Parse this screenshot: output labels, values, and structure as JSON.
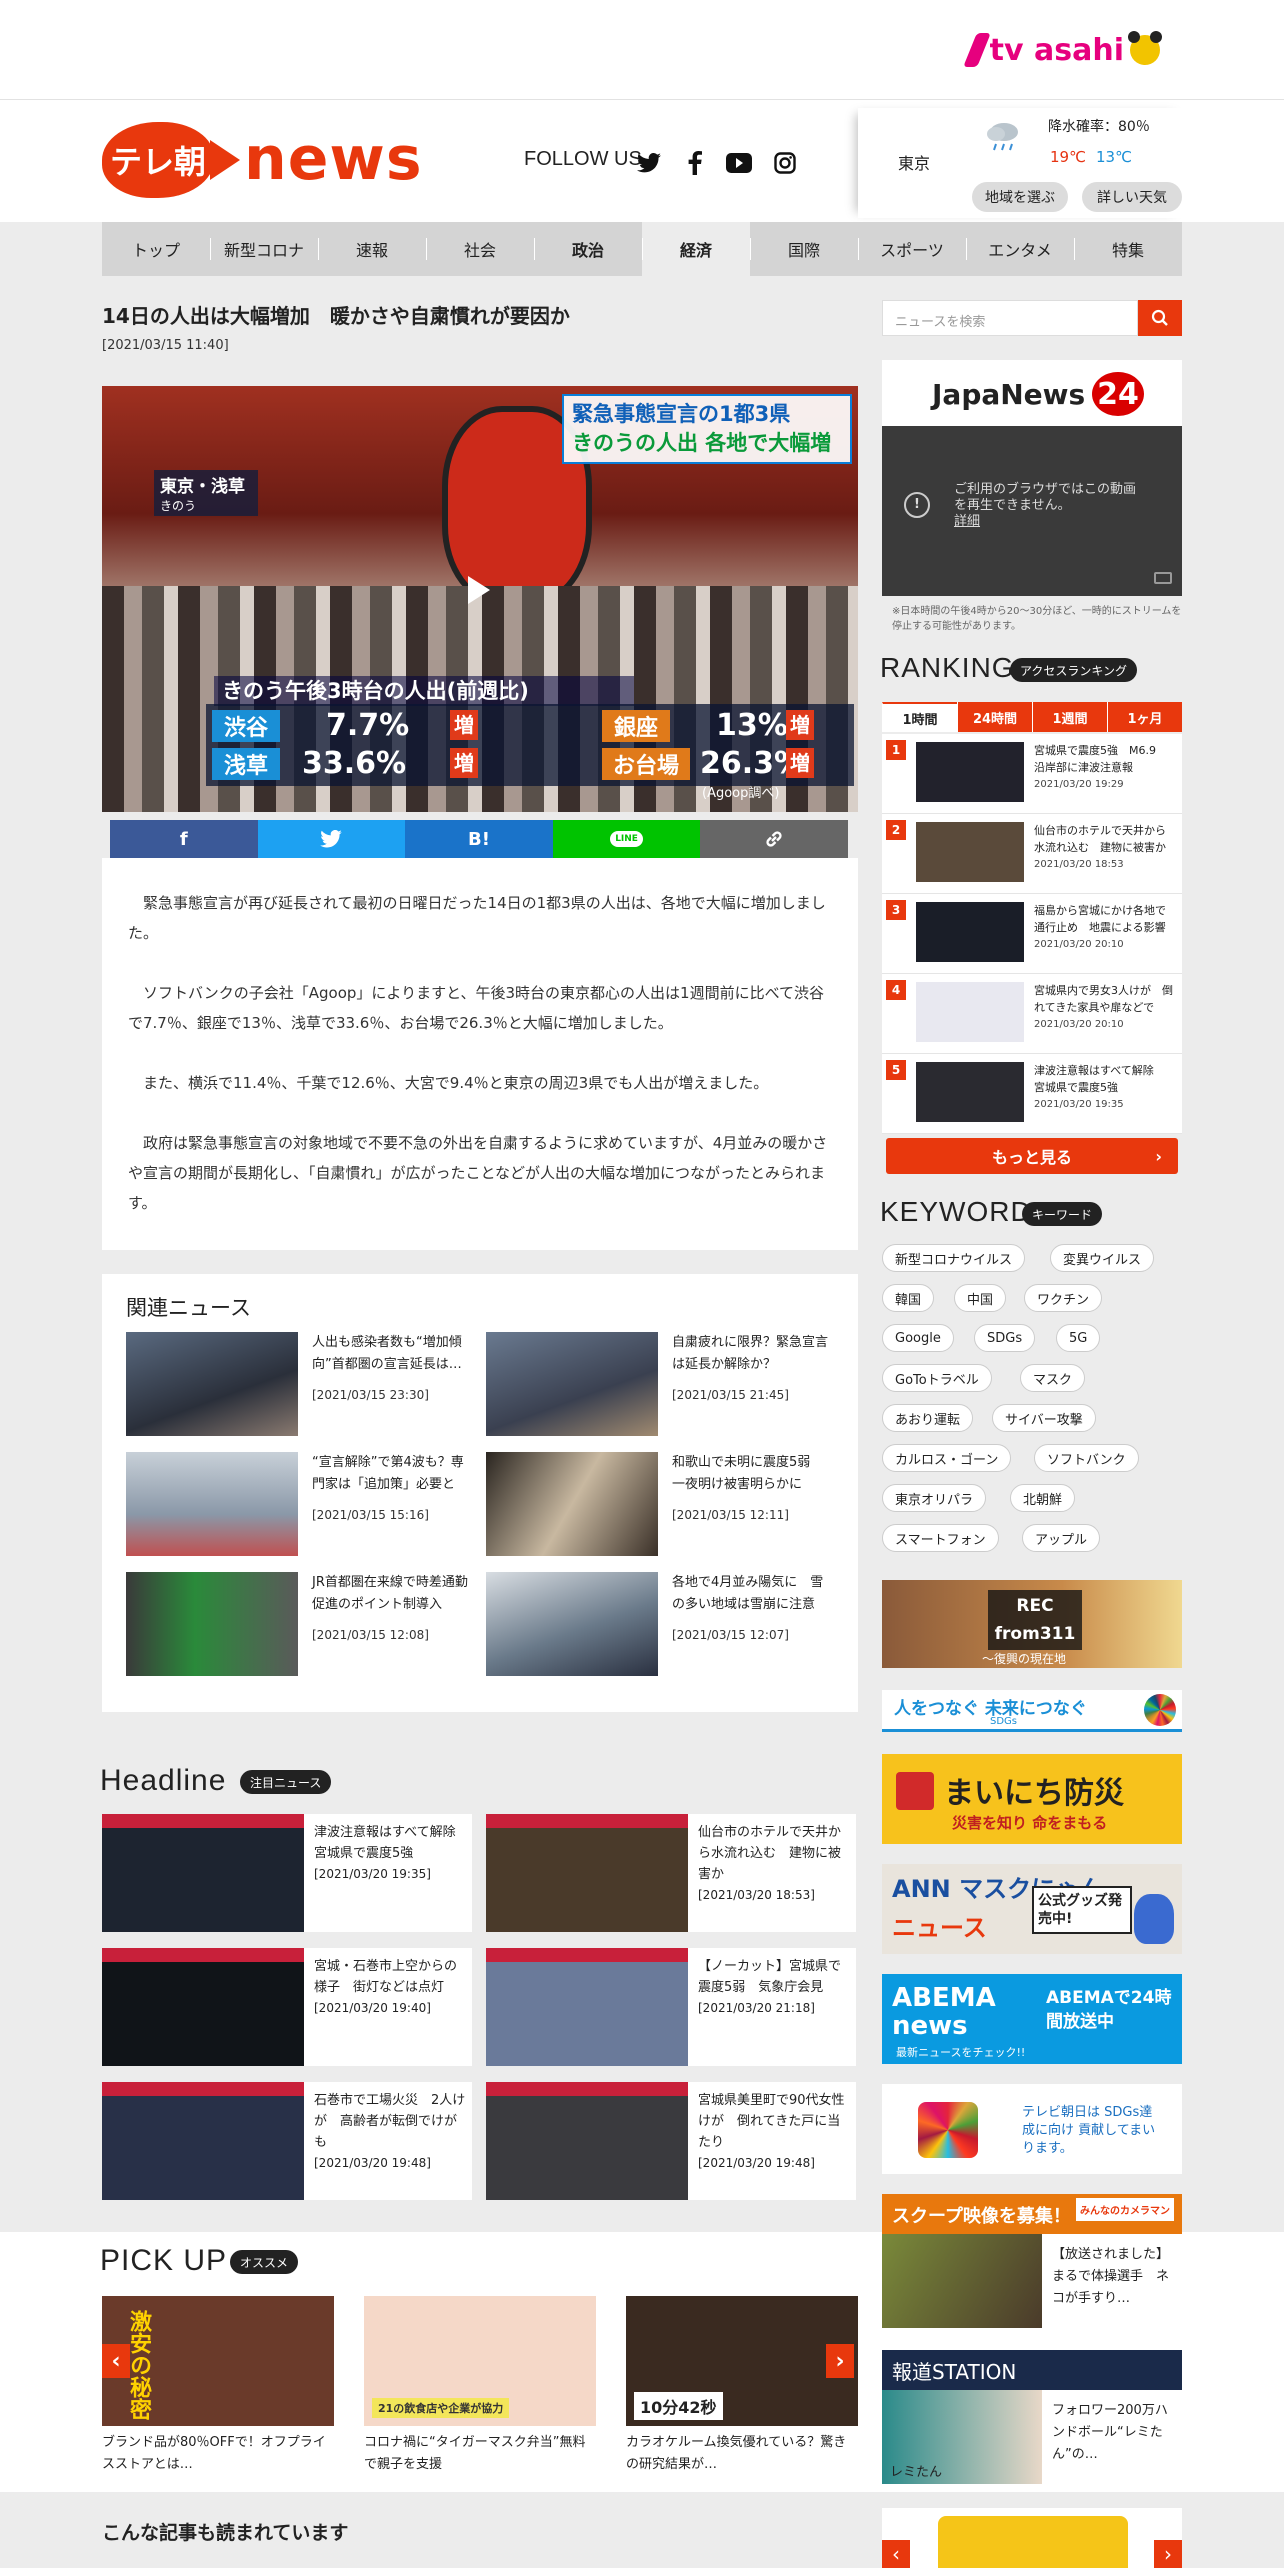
{
  "topbar": {
    "brand": "tv asahi"
  },
  "header": {
    "logo_jp": "テレ朝",
    "logo_en": "news",
    "follow_us": "FOLLOW US",
    "social": [
      "twitter-icon",
      "facebook-icon",
      "youtube-icon",
      "instagram-icon"
    ]
  },
  "weather": {
    "city": "東京",
    "rain": "降水確率：80％",
    "high": "19℃",
    "low": "13℃",
    "region_btn": "地域を選ぶ",
    "detail_btn": "詳しい天気"
  },
  "nav": {
    "items": [
      "トップ",
      "新型コロナ",
      "速報",
      "社会",
      "政治",
      "経済",
      "国際",
      "スポーツ",
      "エンタメ",
      "特集"
    ],
    "active": "経済"
  },
  "article": {
    "title": "14日の人出は大幅増加　暖かさや自粛慣れが要因か",
    "date": "[2021/03/15 11:40]",
    "video": {
      "banner_line1": "緊急事態宣言の1都3県",
      "banner_line2": "きのうの人出 各地で大幅増",
      "loc_line1": "東京・浅草",
      "loc_line2": "きのう",
      "caption": "きのう午後3時台の人出(前週比)",
      "stats": [
        {
          "place": "渋谷",
          "value": "7.7%",
          "change": "増"
        },
        {
          "place": "銀座",
          "value": "13%",
          "change": "増"
        },
        {
          "place": "浅草",
          "value": "33.6%",
          "change": "増"
        },
        {
          "place": "お台場",
          "value": "26.3%",
          "change": "増"
        }
      ],
      "source": "(Agoop調べ)"
    },
    "share": [
      {
        "icon": "facebook-icon",
        "label": "f",
        "color": "#3b5998"
      },
      {
        "icon": "twitter-icon",
        "label": "🐦",
        "color": "#1da1f2"
      },
      {
        "icon": "hatena-bookmark-icon",
        "label": "B!",
        "color": "#1a73c9"
      },
      {
        "icon": "line-icon",
        "label": "LINE",
        "color": "#00c300"
      },
      {
        "icon": "link-icon",
        "label": "🔗",
        "color": "#666666"
      }
    ],
    "paragraphs": [
      "　緊急事態宣言が再び延長されて最初の日曜日だった14日の1都3県の人出は、各地で大幅に増加しました。",
      "　ソフトバンクの子会社「Agoop」によりますと、午後3時台の東京都心の人出は1週間前に比べて渋谷で7.7％、銀座で13％、浅草で33.6％、お台場で26.3％と大幅に増加しました。",
      "　また、横浜で11.4％、千葉で12.6％、大宮で9.4％と東京の周辺3県でも人出が増えました。",
      "　政府は緊急事態宣言の対象地域で不要不急の外出を自粛するように求めていますが、4月並みの暖かさや宣言の期間が長期化し、「自粛慣れ」が広がったことなどが人出の大幅な増加につながったとみられます。"
    ]
  },
  "related": {
    "title": "関連ニュース",
    "items": [
      {
        "text": "人出も感染者数も“増加傾向”首都圏の宣言延長は…",
        "date": "[2021/03/15 23:30]"
      },
      {
        "text": "自粛疲れに限界？緊急宣言は延長か解除か？",
        "date": "[2021/03/15 21:45]"
      },
      {
        "text": "“宣言解除”で第4波も？専門家は「追加策」必要と",
        "date": "[2021/03/15 15:16]"
      },
      {
        "text": "和歌山で未明に震度5弱　一夜明け被害明らかに",
        "date": "[2021/03/15 12:11]"
      },
      {
        "text": "JR首都圏在来線で時差通勤促進のポイント制導入",
        "date": "[2021/03/15 12:08]"
      },
      {
        "text": "各地で4月並み陽気に　雪の多い地域は雪崩に注意",
        "date": "[2021/03/15 12:07]"
      }
    ]
  },
  "headline": {
    "title": "Headline",
    "tag": "注目ニュース",
    "items": [
      {
        "text": "津波注意報はすべて解除　宮城県で震度5強",
        "date": "[2021/03/20 19:35]"
      },
      {
        "text": "仙台市のホテルで天井から水流れ込む　建物に被害か",
        "date": "[2021/03/20 18:53]"
      },
      {
        "text": "宮城・石巻市上空からの様子　街灯などは点灯",
        "date": "[2021/03/20 19:40]"
      },
      {
        "text": "【ノーカット】宮城県で震度5弱　気象庁会見",
        "date": "[2021/03/20 21:18]"
      },
      {
        "text": "石巻市で工場火災　2人けが　高齢者が転倒でけがも",
        "date": "[2021/03/20 19:48]"
      },
      {
        "text": "宮城県美里町で90代女性けが　倒れてきた戸に当たり",
        "date": "[2021/03/20 19:48]"
      }
    ]
  },
  "pickup": {
    "title": "PICK UP",
    "tag": "オススメ",
    "items": [
      {
        "text": "ブランド品が80％OFFで！オフプライスストアとは…",
        "img_label": "激安の秘密",
        "color": "#6a3a2a"
      },
      {
        "text": "コロナ禍に“タイガーマスク弁当”無料で親子を支援",
        "img_label": "21の飲食店や企業が協力",
        "color": "#d98a6a"
      },
      {
        "text": "カラオケルーム換気優れている？驚きの研究結果が…",
        "img_label": "10分42秒",
        "color": "#3a2a20"
      }
    ]
  },
  "more_articles_title": "こんな記事も読まれています",
  "sidebar": {
    "search_placeholder": "ニュースを検索",
    "japanews": {
      "logo": "JapaNews",
      "logo_num": "24",
      "video_msg_1": "ご利用のブラウザではこの動画",
      "video_msg_2": "を再生できません。",
      "video_link": "詳細",
      "note": "※日本時間の午後4時から20～30分ほど、一時的にストリームを停止する可能性があります。"
    },
    "ranking": {
      "title": "RANKING",
      "tag": "アクセスランキング",
      "tabs": [
        "1時間",
        "24時間",
        "1週間",
        "1ヶ月"
      ],
      "items": [
        {
          "num": "1",
          "text": "宮城県で震度5強　M6.9　沿岸部に津波注意報",
          "date": "2021/03/20 19:29"
        },
        {
          "num": "2",
          "text": "仙台市のホテルで天井から水流れ込む　建物に被害か",
          "date": "2021/03/20 18:53"
        },
        {
          "num": "3",
          "text": "福島から宮城にかけ各地で通行止め　地震による影響",
          "date": "2021/03/20 20:10"
        },
        {
          "num": "4",
          "text": "宮城県内で男女3人けが　倒れてきた家具や扉などで",
          "date": "2021/03/20 20:10"
        },
        {
          "num": "5",
          "text": "津波注意報はすべて解除　宮城県で震度5強",
          "date": "2021/03/20 19:35"
        }
      ],
      "more": "もっと見る"
    },
    "keyword": {
      "title": "KEYWORD",
      "tag": "キーワード",
      "items": [
        "新型コロナウイルス",
        "変異ウイルス",
        "韓国",
        "中国",
        "ワクチン",
        "Google",
        "SDGs",
        "5G",
        "GoToトラベル",
        "マスク",
        "あおり運転",
        "サイバー攻撃",
        "カルロス・ゴーン",
        "ソフトバンク",
        "東京オリパラ",
        "北朝鮮",
        "スマートフォン",
        "アップル"
      ]
    },
    "banners": {
      "rec_title": "REC from311",
      "rec_sub": "～復興の現在地",
      "sdgs": "人をつなぐ 未来につなぐ",
      "sdgs_sub": "SDGs",
      "bousai": "まいにち防災",
      "bousai_sub": "災害を知り 命をまもる",
      "mask_line1": "ANN マスクにゃん",
      "mask_line2": "ニュース",
      "mask_badge": "公式グッズ発売中!",
      "abema_logo": "ABEMA news",
      "abema_text": "ABEMAで24時間放送中",
      "abema_sub": "最新ニュースをチェック!!",
      "sdgs2": "テレビ朝日は SDGs達成に向け 貢献してまいります。",
      "scoop_title": "スクープ映像を募集！",
      "scoop_badge": "みんなのカメラマン",
      "scoop_text": "【放送されました】まるで体操選手　ネコが手すり…",
      "station_title": "報道STATION",
      "station_text": "フォロワー200万ハンドボール“レミたん”の…",
      "station_name": "レミたん"
    }
  }
}
